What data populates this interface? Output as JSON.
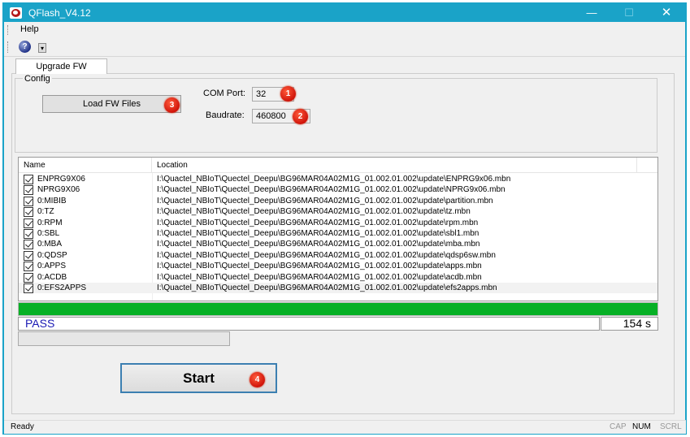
{
  "window": {
    "title": "QFlash_V4.12",
    "minimize": "—",
    "maximize": "☐",
    "close": "✕"
  },
  "menu": {
    "help": "Help"
  },
  "toolbar": {
    "help_icon": "?",
    "overflow": "▾"
  },
  "tab": {
    "label": "Upgrade FW"
  },
  "config": {
    "group_label": "Config",
    "load_button": "Load FW Files",
    "com_port_label": "COM Port:",
    "com_port_value": "32",
    "baudrate_label": "Baudrate:",
    "baudrate_value": "460800"
  },
  "badges": {
    "b1": "1",
    "b2": "2",
    "b3": "3",
    "b4": "4"
  },
  "file_list": {
    "columns": {
      "name": "Name",
      "location": "Location"
    },
    "rows": [
      {
        "name": "ENPRG9X06",
        "location": "I:\\Quactel_NBIoT\\Quectel_Deepu\\BG96MAR04A02M1G_01.002.01.002\\update\\ENPRG9x06.mbn"
      },
      {
        "name": "NPRG9X06",
        "location": "I:\\Quactel_NBIoT\\Quectel_Deepu\\BG96MAR04A02M1G_01.002.01.002\\update\\NPRG9x06.mbn"
      },
      {
        "name": "0:MIBIB",
        "location": "I:\\Quactel_NBIoT\\Quectel_Deepu\\BG96MAR04A02M1G_01.002.01.002\\update\\partition.mbn"
      },
      {
        "name": "0:TZ",
        "location": "I:\\Quactel_NBIoT\\Quectel_Deepu\\BG96MAR04A02M1G_01.002.01.002\\update\\tz.mbn"
      },
      {
        "name": "0:RPM",
        "location": "I:\\Quactel_NBIoT\\Quectel_Deepu\\BG96MAR04A02M1G_01.002.01.002\\update\\rpm.mbn"
      },
      {
        "name": "0:SBL",
        "location": "I:\\Quactel_NBIoT\\Quectel_Deepu\\BG96MAR04A02M1G_01.002.01.002\\update\\sbl1.mbn"
      },
      {
        "name": "0:MBA",
        "location": "I:\\Quactel_NBIoT\\Quectel_Deepu\\BG96MAR04A02M1G_01.002.01.002\\update\\mba.mbn"
      },
      {
        "name": "0:QDSP",
        "location": "I:\\Quactel_NBIoT\\Quectel_Deepu\\BG96MAR04A02M1G_01.002.01.002\\update\\qdsp6sw.mbn"
      },
      {
        "name": "0:APPS",
        "location": "I:\\Quactel_NBIoT\\Quectel_Deepu\\BG96MAR04A02M1G_01.002.01.002\\update\\apps.mbn"
      },
      {
        "name": "0:ACDB",
        "location": "I:\\Quactel_NBIoT\\Quectel_Deepu\\BG96MAR04A02M1G_01.002.01.002\\update\\acdb.mbn"
      },
      {
        "name": "0:EFS2APPS",
        "location": "I:\\Quactel_NBIoT\\Quectel_Deepu\\BG96MAR04A02M1G_01.002.01.002\\update\\efs2apps.mbn"
      }
    ]
  },
  "progress": {
    "fraction": 1.0,
    "color": "#06b025"
  },
  "result": {
    "status": "PASS",
    "elapsed": "154 s"
  },
  "start_button": "Start",
  "statusbar": {
    "ready": "Ready",
    "cap": "CAP",
    "num": "NUM",
    "scrl": "SCRL"
  },
  "colors": {
    "titlebar": "#1aa3c8",
    "badge": "#e0200f",
    "status_text": "#1a1ab4"
  }
}
